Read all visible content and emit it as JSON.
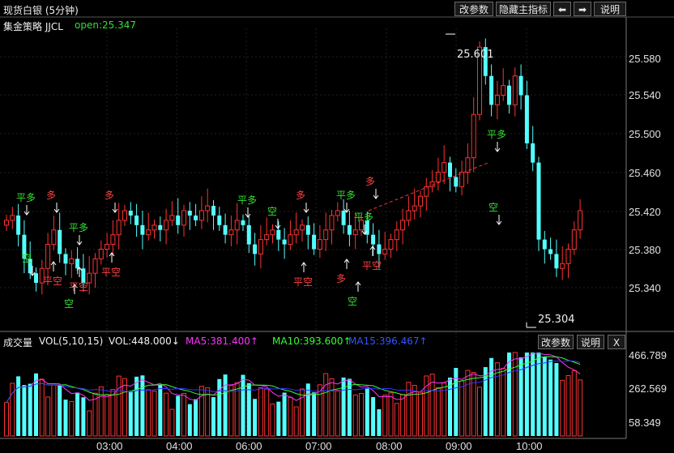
{
  "title": "现货白银 (5分钟)",
  "toolbar": {
    "edit_params": "改参数",
    "hide_indicator": "隐藏主指标",
    "left_arrow": "⬅",
    "right_arrow": "➡",
    "help": "说明"
  },
  "main": {
    "strategy_name": "集金策略 JJCL",
    "open_label": "open:25.347",
    "high_label": "25.601",
    "low_label": "25.304",
    "y_ticks": [
      "25.580",
      "25.540",
      "25.500",
      "25.460",
      "25.420",
      "25.380",
      "25.340"
    ]
  },
  "signals": [
    {
      "text": "平多",
      "color": "#33e033",
      "dir": "down"
    },
    {
      "text": "空",
      "color": "#33e033",
      "dir": "down"
    },
    {
      "text": "平空",
      "color": "#ff4040",
      "dir": "up"
    },
    {
      "text": "多",
      "color": "#ff4040",
      "dir": "down"
    },
    {
      "text": "平多",
      "color": "#33e033",
      "dir": "down"
    },
    {
      "text": "空",
      "color": "#33e033",
      "dir": "up"
    },
    {
      "text": "平空",
      "color": "#ff4040",
      "dir": "up"
    },
    {
      "text": "多",
      "color": "#ff4040",
      "dir": "down"
    },
    {
      "text": "平空",
      "color": "#ff4040",
      "dir": "up"
    },
    {
      "text": "平多",
      "color": "#33e033",
      "dir": "down"
    },
    {
      "text": "空",
      "color": "#33e033",
      "dir": "down"
    },
    {
      "text": "平空",
      "color": "#ff4040",
      "dir": "up"
    },
    {
      "text": "多",
      "color": "#ff4040",
      "dir": "down"
    },
    {
      "text": "平多",
      "color": "#33e033",
      "dir": "down"
    },
    {
      "text": "平多",
      "color": "#33e033",
      "dir": "down"
    },
    {
      "text": "多",
      "color": "#ff4040",
      "dir": "up"
    },
    {
      "text": "空",
      "color": "#33e033",
      "dir": "up"
    },
    {
      "text": "平空",
      "color": "#ff4040",
      "dir": "up"
    },
    {
      "text": "多",
      "color": "#ff4040",
      "dir": "down"
    },
    {
      "text": "平多",
      "color": "#33e033",
      "dir": "down"
    },
    {
      "text": "空",
      "color": "#33e033",
      "dir": "down"
    }
  ],
  "volume": {
    "label": "成交量",
    "params": "VOL(5,10,15)",
    "vol": "VOL:448.000",
    "vol_arrow": "↓",
    "ma5": "MA5:381.400",
    "ma5_arrow": "↑",
    "ma10": "MA10:393.600",
    "ma10_arrow": "↑",
    "ma15": "MA15:396.467",
    "ma15_arrow": "↑",
    "edit_params": "改参数",
    "help": "说明",
    "close": "X",
    "y_ticks": [
      "466.789",
      "262.569",
      "58.349"
    ]
  },
  "x_ticks": [
    "03:00",
    "04:00",
    "06:00",
    "07:00",
    "08:00",
    "09:00",
    "10:00"
  ],
  "colors": {
    "up": "#ff3232",
    "down": "#54ffff",
    "ma5": "#ff33ff",
    "ma10": "#33ff33",
    "ma15": "#3333ff",
    "grid": "#2a2a2a"
  }
}
